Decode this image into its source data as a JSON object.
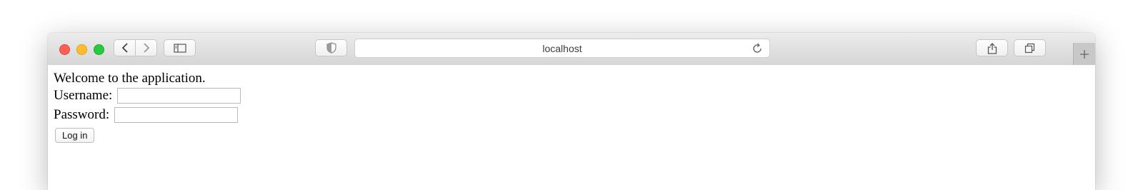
{
  "browser": {
    "address": "localhost",
    "icons": {
      "back": "chevron-left-icon",
      "forward": "chevron-right-icon",
      "sidebar": "sidebar-icon",
      "privacy": "shield-icon",
      "reload": "reload-icon",
      "share": "share-icon",
      "tabs": "tab-overview-icon",
      "new_tab": "plus-icon"
    },
    "traffic_colors": {
      "close": "#fe5f57",
      "minimize": "#febc2e",
      "maximize": "#28c840"
    }
  },
  "page": {
    "welcome": "Welcome to the application.",
    "username_label": "Username:",
    "username_value": "",
    "password_label": "Password:",
    "password_value": "",
    "login_button": "Log in"
  }
}
